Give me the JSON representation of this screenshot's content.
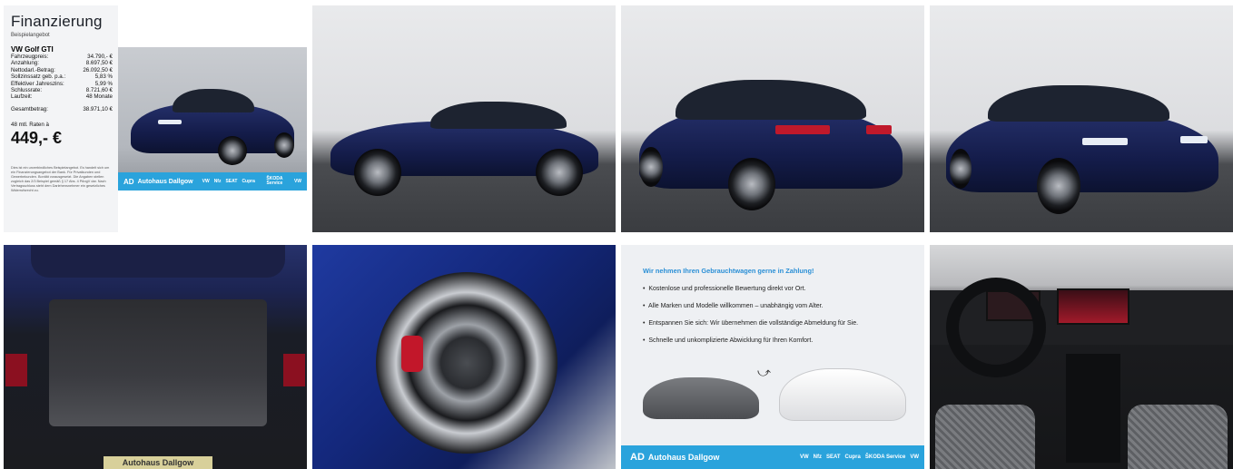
{
  "finance": {
    "title": "Finanzierung",
    "subtitle": "Beispielangebot",
    "model": "VW Golf GTI",
    "rows": [
      {
        "label": "Fahrzeugpreis:",
        "value": "34.790,- €"
      },
      {
        "label": "Anzahlung:",
        "value": "8.697,50 €"
      },
      {
        "label": "Nettodarl.-Betrag:",
        "value": "26.092,50 €"
      },
      {
        "label": "Sollzinssatz geb. p.a.:",
        "value": "5,83 %"
      },
      {
        "label": "Effektiver Jahreszins:",
        "value": "5,99 %"
      },
      {
        "label": "Schlussrate:",
        "value": "8.721,60 €"
      },
      {
        "label": "Laufzeit:",
        "value": "48 Monate"
      }
    ],
    "total_label": "Gesamtbetrag:",
    "total_value": "38.971,10 €",
    "rate_label": "48 mtl. Raten à",
    "rate_value": "449,- €",
    "fineprint": "Dies ist ein unverbindliches Beispielangebot. Es handelt sich um ein Finanzierungsangebot der Bank. Für Privatkunden und Gewerbekunden. Bonität vorausgesetzt. Die Angaben stellen zugleich das 2/3 Beispiel gemäß § 17 Abs. 4 PAngV dar. Nach Vertragsschluss steht dem Darlehensnehmer ein gesetzliches Widerrufsrecht zu."
  },
  "banner": {
    "logo_mark": "AD",
    "dealer": "Autohaus Dallgow",
    "brands": [
      "VW",
      "Nfz",
      "SEAT",
      "Cupra",
      "ŠKODA Service",
      "VW"
    ]
  },
  "trunk": {
    "plate": "Autohaus Dallgow"
  },
  "tradein": {
    "heading": "Wir nehmen Ihren Gebrauchtwagen gerne in Zahlung!",
    "items": [
      "Kostenlose und professionelle Bewertung direkt vor Ort.",
      "Alle Marken und Modelle willkommen – unabhängig vom Alter.",
      "Entspannen Sie sich: Wir übernehmen die vollständige Abmeldung für Sie.",
      "Schnelle und unkomplizierte Abwicklung für Ihren Komfort."
    ]
  },
  "colors": {
    "brand_blue": "#2aa3dc",
    "car_blue": "#1b2660"
  }
}
